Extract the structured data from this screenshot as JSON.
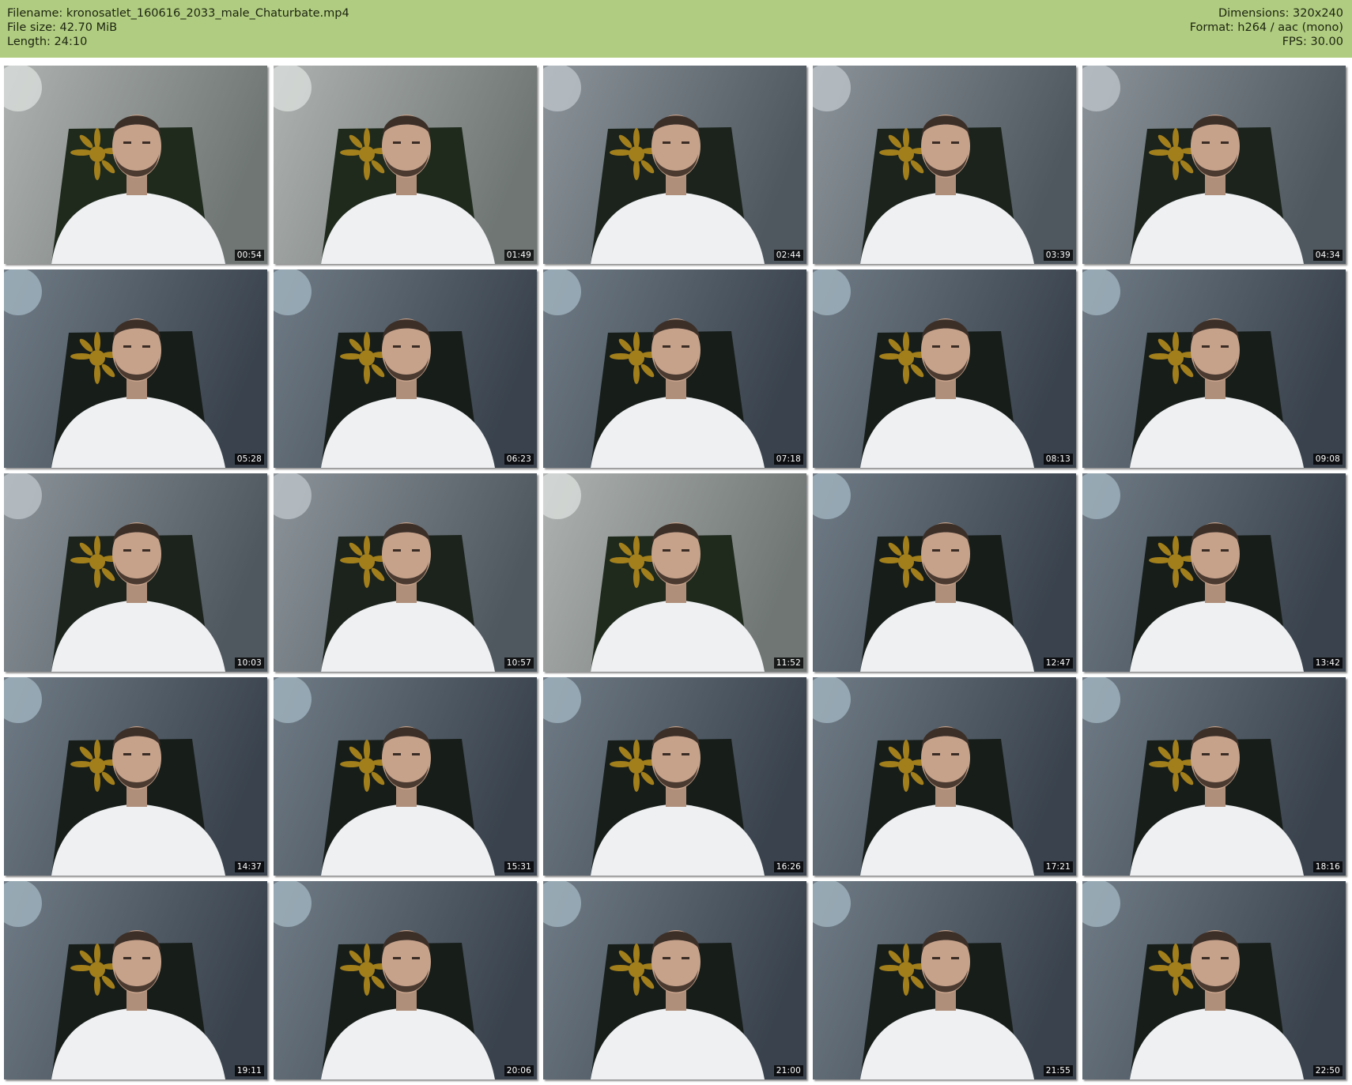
{
  "header": {
    "filename": "Filename: kronosatlet_160616_2033_male_Chaturbate.mp4",
    "file_size": "File size: 42.70 MiB",
    "length": "Length: 24:10",
    "dimensions": "Dimensions: 320x240",
    "format": "Format: h264 / aac (mono)",
    "fps": "FPS: 30.00"
  },
  "colors": {
    "header_bg": "#b0cc80",
    "page_bg": "#ffffff",
    "timestamp_bg": "#000000",
    "timestamp_text": "#ffffff"
  },
  "thumbnails": [
    {
      "timestamp": "00:54",
      "tone": "bright"
    },
    {
      "timestamp": "01:49",
      "tone": "bright"
    },
    {
      "timestamp": "02:44",
      "tone": "mid"
    },
    {
      "timestamp": "03:39",
      "tone": "mid"
    },
    {
      "timestamp": "04:34",
      "tone": "mid"
    },
    {
      "timestamp": "05:28",
      "tone": "dark"
    },
    {
      "timestamp": "06:23",
      "tone": "dark"
    },
    {
      "timestamp": "07:18",
      "tone": "dark"
    },
    {
      "timestamp": "08:13",
      "tone": "dark"
    },
    {
      "timestamp": "09:08",
      "tone": "dark"
    },
    {
      "timestamp": "10:03",
      "tone": "mid"
    },
    {
      "timestamp": "10:57",
      "tone": "mid"
    },
    {
      "timestamp": "11:52",
      "tone": "bright"
    },
    {
      "timestamp": "12:47",
      "tone": "dark"
    },
    {
      "timestamp": "13:42",
      "tone": "dark"
    },
    {
      "timestamp": "14:37",
      "tone": "dark"
    },
    {
      "timestamp": "15:31",
      "tone": "dark"
    },
    {
      "timestamp": "16:26",
      "tone": "dark"
    },
    {
      "timestamp": "17:21",
      "tone": "dark"
    },
    {
      "timestamp": "18:16",
      "tone": "dark"
    },
    {
      "timestamp": "19:11",
      "tone": "dark"
    },
    {
      "timestamp": "20:06",
      "tone": "dark"
    },
    {
      "timestamp": "21:00",
      "tone": "dark"
    },
    {
      "timestamp": "21:55",
      "tone": "dark"
    },
    {
      "timestamp": "22:50",
      "tone": "dark"
    }
  ]
}
